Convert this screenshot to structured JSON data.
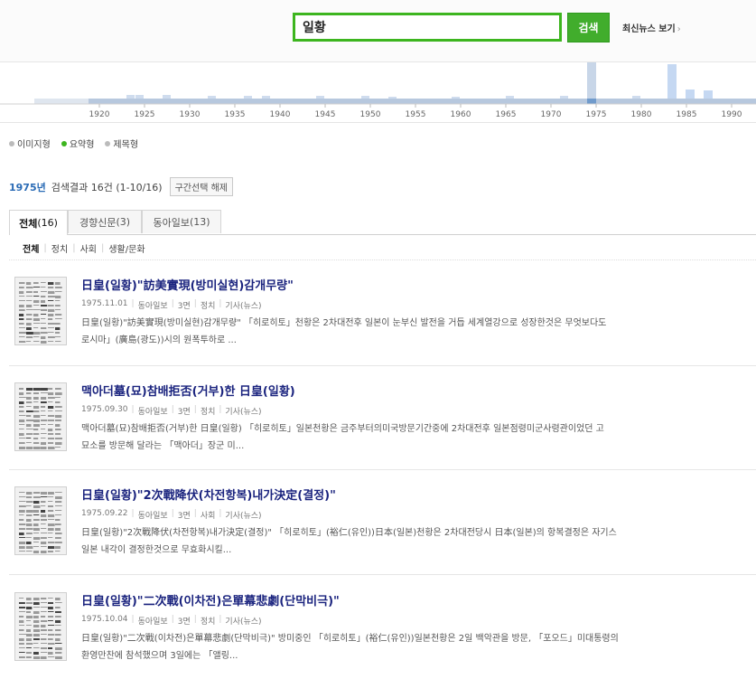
{
  "search": {
    "value": "일황",
    "button_label": "검색"
  },
  "header": {
    "latest_news_label": "최신뉴스 보기",
    "latest_news_arrow": "›"
  },
  "timeline": {
    "labels": [
      "1920",
      "1925",
      "1930",
      "1935",
      "1940",
      "1945",
      "1950",
      "1955",
      "1960",
      "1965",
      "1970",
      "1975",
      "1980",
      "1985",
      "1990"
    ],
    "selected_year": "1975",
    "accent_color": "#2a6bb5"
  },
  "view_options": [
    {
      "label": "이미지형",
      "selected": false
    },
    {
      "label": "요약형",
      "selected": true
    },
    {
      "label": "제목형",
      "selected": false
    }
  ],
  "summary": {
    "year": "1975년",
    "text": "검색결과 16건 (1-10/16)",
    "reset_label": "구간선택 해제"
  },
  "tabs": [
    {
      "label": "전체",
      "count": "(16)"
    },
    {
      "label": "경향신문",
      "count": "(3)"
    },
    {
      "label": "동아일보",
      "count": "(13)"
    }
  ],
  "subcategories": [
    "전체",
    "정치",
    "사회",
    "생활/문화"
  ],
  "results": [
    {
      "title": "日皇(일황)\"訪美實現(방미실현)감개무량\"",
      "date": "1975.11.01",
      "paper": "동아일보",
      "page": "3면",
      "section": "정치",
      "type": "기사(뉴스)",
      "snippet1": "日皇(일황)\"訪美實現(방미실현)감개무량\"  「히로히토」천황은 2차대전후 일본이 눈부신 발전을 거듭 세계열강으로 성장한것은 무엇보다도",
      "snippet2": "로시마」(廣島(광도))시의 원폭투하로 ..."
    },
    {
      "title": "맥아더墓(묘)참배拒否(거부)한 日皇(일황)",
      "date": "1975.09.30",
      "paper": "동아일보",
      "page": "3면",
      "section": "정치",
      "type": "기사(뉴스)",
      "snippet1": "맥아더墓(묘)참배拒否(거부)한 日皇(일황)  「히로히토」일본천황은 금주부터의미국방문기간중에 2차대전후 일본점령미군사령관이었던 고",
      "snippet2": "묘소를 방문해 달라는 「맥아더」장군 미..."
    },
    {
      "title": "日皇(일황)\"2次戰降伏(차전항복)내가決定(결정)\"",
      "date": "1975.09.22",
      "paper": "동아일보",
      "page": "3면",
      "section": "사회",
      "type": "기사(뉴스)",
      "snippet1": "日皇(일황)\"2次戰降伏(차전항복)내가決定(결정)\"  「히로히토」(裕仁(유인))日本(일본)천황은 2차대전당시 日本(일본)의 항복결정은 자기스",
      "snippet2": "일본 내각이 결정한것으로 무효화시킬..."
    },
    {
      "title": "日皇(일황)\"二次戰(이차전)은單幕悲劇(단막비극)\"",
      "date": "1975.10.04",
      "paper": "동아일보",
      "page": "3면",
      "section": "정치",
      "type": "기사(뉴스)",
      "snippet1": "日皇(일황)\"二次戰(이차전)은單幕悲劇(단막비극)\" 방미중인 「히로히토」(裕仁(유인))일본천황은 2일 백악관을 방문, 「포오드」미대통령의",
      "snippet2": "환영만찬에 참석했으며 3일에는 「앨링..."
    }
  ]
}
